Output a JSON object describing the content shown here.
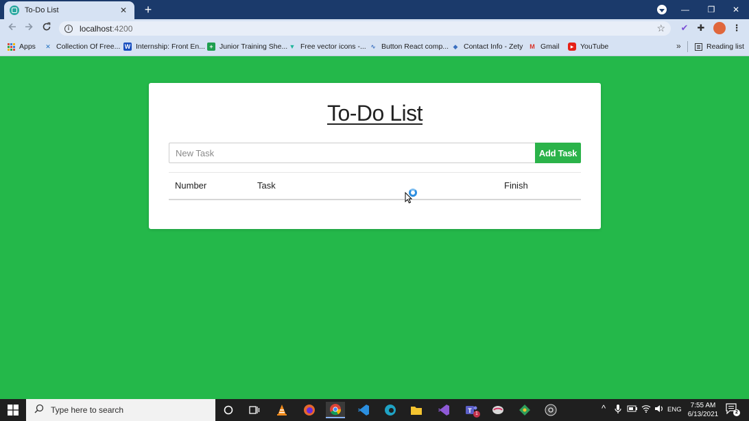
{
  "browser": {
    "tab_title": "To-Do List",
    "tab_close": "✕",
    "new_tab": "+",
    "url_host": "localhost",
    "url_port": ":4200",
    "window_controls": {
      "minimize": "—",
      "restore": "❐",
      "close": "✕"
    }
  },
  "bookmarks": [
    {
      "label": "Apps",
      "icon": "apps-grid-icon"
    },
    {
      "label": "Collection Of Free...",
      "icon": "collection-icon"
    },
    {
      "label": "Internship: Front En...",
      "icon": "w-icon"
    },
    {
      "label": "Junior Training She...",
      "icon": "sheets-icon"
    },
    {
      "label": "Free vector icons -...",
      "icon": "vector-icon"
    },
    {
      "label": "Button React comp...",
      "icon": "react-icon"
    },
    {
      "label": "Contact Info - Zety",
      "icon": "zety-icon"
    },
    {
      "label": "Gmail",
      "icon": "gmail-icon"
    },
    {
      "label": "YouTube",
      "icon": "youtube-icon"
    }
  ],
  "reading_list": "Reading list",
  "bookmarks_more": "»",
  "app": {
    "title": "To-Do List",
    "input_placeholder": "New Task",
    "input_value": "",
    "add_button": "Add Task",
    "columns": [
      "Number",
      "Task",
      "Finish"
    ],
    "rows": []
  },
  "taskbar": {
    "search_placeholder": "Type here to search",
    "language": "ENG",
    "time": "7:55 AM",
    "date": "6/13/2021",
    "notification_count": "2",
    "teams_badge": "1"
  },
  "colors": {
    "page_background": "#24b84a",
    "accent_button": "#2bb34a",
    "browser_frame": "#1b3a6b"
  }
}
